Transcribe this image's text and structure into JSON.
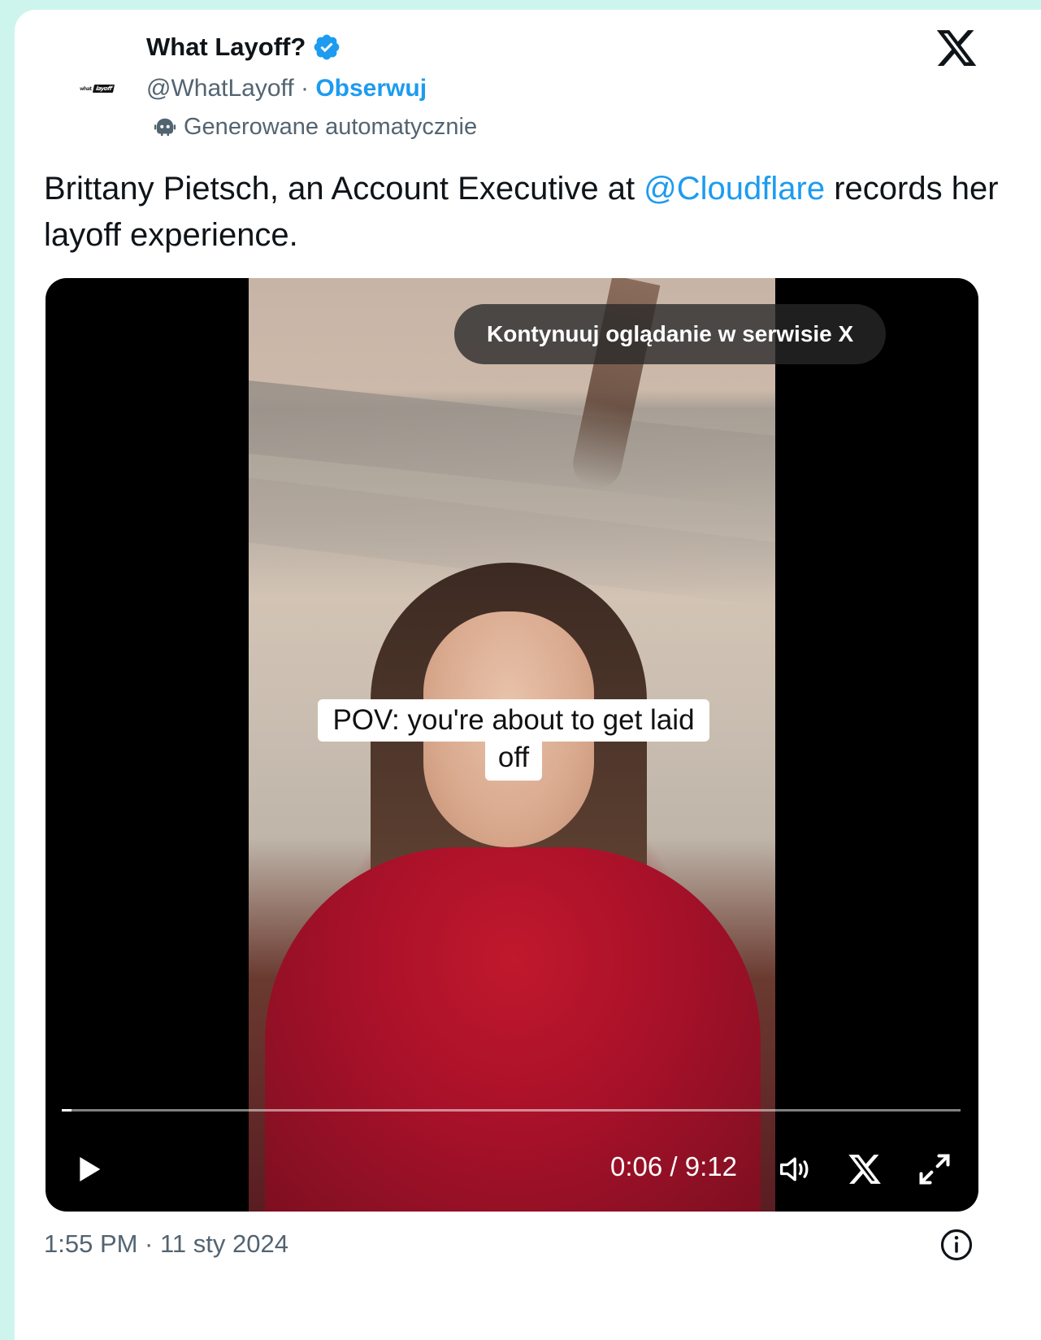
{
  "author": {
    "display_name": "What Layoff?",
    "handle": "@WhatLayoff",
    "separator": " · ",
    "follow_label": "Obserwuj",
    "auto_label": "Generowane automatycznie",
    "avatar_logo_small": "what",
    "avatar_logo_box": "layoff",
    "verified_color": "#1d9bf0"
  },
  "tweet": {
    "text_before": "Brittany Pietsch, an Account Executive at ",
    "mention": "@Cloudflare",
    "text_after": " records her layoff experience.",
    "mention_color": "#1d9bf0"
  },
  "video": {
    "continue_label": "Kontynuuj oglądanie w serwisie X",
    "caption_line1": "POV: you're about to get laid",
    "caption_line2": "off",
    "time_display": "0:06 / 9:12",
    "progress_fraction": 0.011
  },
  "footer": {
    "timestamp": "1:55 PM · 11 sty 2024"
  },
  "icons": {
    "close_brand": "x-logo-icon",
    "verified": "verified-badge-icon",
    "bot": "bot-icon",
    "play": "play-icon",
    "volume": "volume-icon",
    "x_small": "x-logo-icon",
    "expand": "expand-icon",
    "info": "info-icon"
  }
}
